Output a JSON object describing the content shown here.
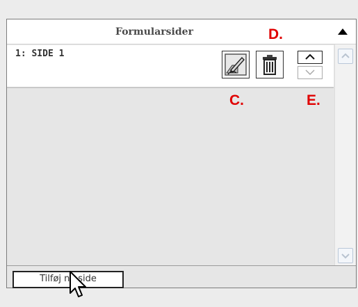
{
  "panel": {
    "title": "Formularsider",
    "pages": [
      {
        "label": "1: SIDE 1"
      }
    ]
  },
  "footer": {
    "add_page_label": "Tilføj ny side"
  },
  "annotations": {
    "c": "C.",
    "d": "D.",
    "e": "E."
  },
  "colors": {
    "annotation": "#e00000",
    "panel_bg": "#e6e6e6"
  },
  "icons": {
    "edit": "edit-pencil-icon",
    "delete": "trash-icon",
    "move_up": "chevron-up-icon",
    "move_down": "chevron-down-icon",
    "collapse": "triangle-up-icon",
    "cursor": "mouse-pointer-icon"
  }
}
